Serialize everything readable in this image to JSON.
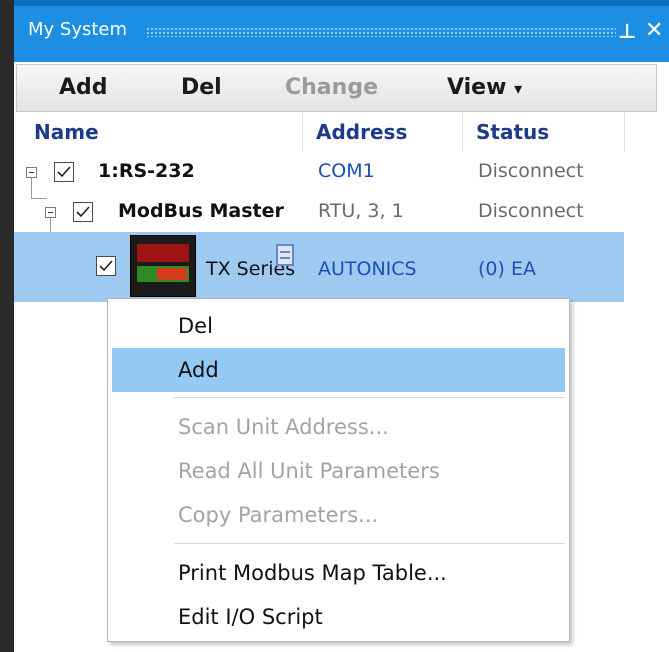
{
  "window": {
    "title": "My System",
    "pin_icon": "pin-icon",
    "close_icon": "close-icon"
  },
  "toolbar": {
    "add_label": "Add",
    "del_label": "Del",
    "change_label": "Change",
    "view_label": "View",
    "view_arrow": "▾"
  },
  "columns": {
    "name": "Name",
    "address": "Address",
    "status": "Status"
  },
  "tree": {
    "rows": [
      {
        "name": "1:RS-232",
        "address": "COM1",
        "status": "Disconnect"
      },
      {
        "name": "ModBus Master",
        "address": "RTU, 3, 1",
        "status": "Disconnect"
      },
      {
        "name": "TX Series",
        "address": "AUTONICS",
        "status": "(0) EA"
      }
    ]
  },
  "context_menu": {
    "items": [
      {
        "label": "Del",
        "enabled": true
      },
      {
        "label": "Add",
        "enabled": true,
        "highlighted": true
      },
      {
        "label": "Scan Unit Address...",
        "enabled": false
      },
      {
        "label": "Read All Unit Parameters",
        "enabled": false
      },
      {
        "label": "Copy Parameters...",
        "enabled": false
      },
      {
        "label": "Print Modbus Map Table...",
        "enabled": true
      },
      {
        "label": "Edit I/O Script",
        "enabled": true
      }
    ]
  },
  "colors": {
    "titlebar": "#1c8ee3",
    "selection": "#9ec9f0",
    "menu_highlight": "#94c8f5",
    "header_text": "#1f3a8a",
    "address_text": "#1e4fb3"
  }
}
